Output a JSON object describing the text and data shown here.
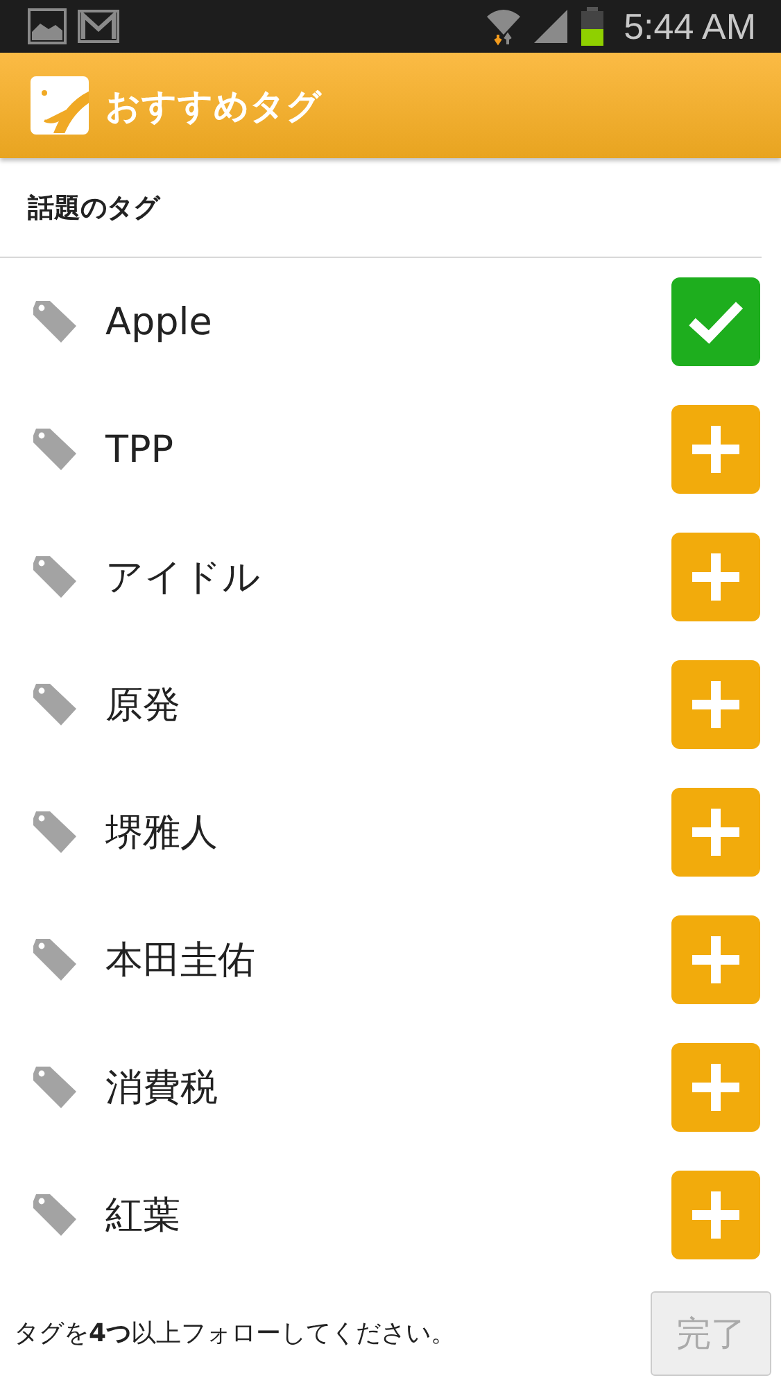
{
  "status_bar": {
    "time": "5:44 AM"
  },
  "app_bar": {
    "title": "おすすめタグ"
  },
  "section": {
    "title": "話題のタグ"
  },
  "tags": [
    {
      "label": "Apple",
      "followed": true
    },
    {
      "label": "TPP",
      "followed": false
    },
    {
      "label": "アイドル",
      "followed": false
    },
    {
      "label": "原発",
      "followed": false
    },
    {
      "label": "堺雅人",
      "followed": false
    },
    {
      "label": "本田圭佑",
      "followed": false
    },
    {
      "label": "消費税",
      "followed": false
    },
    {
      "label": "紅葉",
      "followed": false
    }
  ],
  "footer": {
    "message": "タグを**4つ**以上フォローしてください。",
    "button": {
      "label": "完了",
      "disabled": true
    }
  }
}
